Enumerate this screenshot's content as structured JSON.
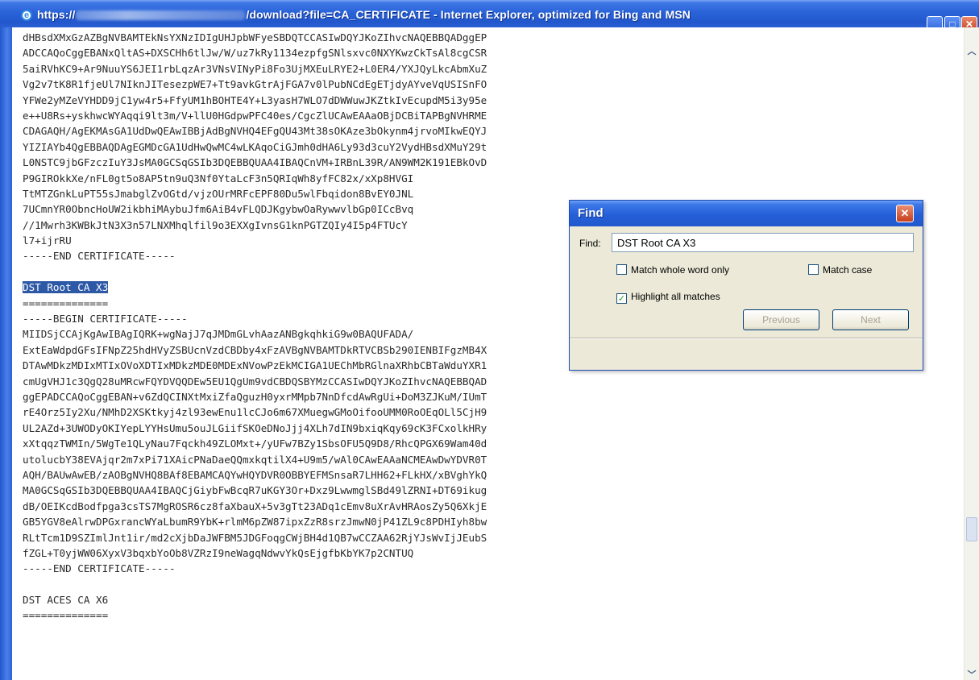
{
  "window": {
    "title_prefix": "https://",
    "title_suffix": "/download?file=CA_CERTIFICATE - Internet Explorer, optimized for Bing and MSN",
    "minimize_symbol": "_",
    "maximize_symbol": "□",
    "close_symbol": "✕"
  },
  "scrollbar": {
    "up_arrow": "︿",
    "down_arrow": "﹀"
  },
  "document": {
    "lines": [
      "dHBsdXMxGzAZBgNVBAMTEkNsYXNzIDIgUHJpbWFyeSBDQTCCASIwDQYJKoZIhvcNAQEBBQADggEP",
      "ADCCAQoCggEBANxQltAS+DXSCHh6tlJw/W/uz7kRy1134ezpfgSNlsxvc0NXYKwzCkTsAl8cgCSR",
      "5aiRVhKC9+Ar9NuuYS6JEI1rbLqzAr3VNsVINyPi8Fo3UjMXEuLRYE2+L0ER4/YXJQyLkcAbmXuZ",
      "Vg2v7tK8R1fjeUl7NIknJITesezpWE7+Tt9avkGtrAjFGA7v0lPubNCdEgETjdyAYveVqUSISnFO",
      "YFWe2yMZeVYHDD9jC1yw4r5+FfyUM1hBOHTE4Y+L3yasH7WLO7dDWWuwJKZtkIvEcupdM5i3y95e",
      "e++U8Rs+yskhwcWYAqqi9lt3m/V+llU0HGdpwPFC40es/CgcZlUCAwEAAaOBjDCBiTAPBgNVHRME",
      "CDAGAQH/AgEKMAsGA1UdDwQEAwIBBjAdBgNVHQ4EFgQU43Mt38sOKAze3bOkynm4jrvoMIkwEQYJ",
      "YIZIAYb4QgEBBAQDAgEGMDcGA1UdHwQwMC4wLKAqoCiGJmh0dHA6Ly93d3cuY2VydHBsdXMuY29t",
      "L0NSTC9jbGFzczIuY3JsMA0GCSqGSIb3DQEBBQUAA4IBAQCnVM+IRBnL39R/AN9WM2K191EBkOvD",
      "P9GIROkkXe/nFL0gt5o8AP5tn9uQ3Nf0YtaLcF3n5QRIqWh8yfFC82x/xXp8HVGI",
      "TtMTZGnkLuPT55sJmabglZvOGtd/vjzOUrMRFcEPF80Du5wlFbqidon8BvEY0JNL",
      "7UCmnYR0ObncHoUW2ikbhiMAybuJfm6AiB4vFLQDJKgybwOaRywwvlbGp0ICcBvq",
      "//1Mwrh3KWBkJtN3X3n57LNXMhqlfil9o3EXXgIvnsG1knPGTZQIy4I5p4FTUcY",
      "l7+ijrRU",
      "-----END CERTIFICATE-----",
      "",
      "DST Root CA X3",
      "==============",
      "-----BEGIN CERTIFICATE-----",
      "MIIDSjCCAjKgAwIBAgIQRK+wgNajJ7qJMDmGLvhAazANBgkqhkiG9w0BAQUFADA/",
      "ExtEaWdpdGFsIFNpZ25hdHVyZSBUcnVzdCBDby4xFzAVBgNVBAMTDkRTVCBSb290IENBIFgzMB4X",
      "DTAwMDkzMDIxMTIxOVoXDTIxMDkzMDE0MDExNVowPzEkMCIGA1UEChMbRGlnaXRhbCBTaWduYXR1",
      "cmUgVHJ1c3QgQ28uMRcwFQYDVQQDEw5EU1QgUm9vdCBDQSBYMzCCASIwDQYJKoZIhvcNAQEBBQAD",
      "ggEPADCCAQoCggEBAN+v6ZdQCINXtMxiZfaQguzH0yxrMMpb7NnDfcdAwRgUi+DoM3ZJKuM/IUmT",
      "rE4Orz5Iy2Xu/NMhD2XSKtkyj4zl93ewEnu1lcCJo6m67XMuegwGMoOifooUMM0RoOEqOLl5CjH9",
      "UL2AZd+3UWODyOKIYepLYYHsUmu5ouJLGiifSKOeDNoJjj4XLh7dIN9bxiqKqy69cK3FCxolkHRy",
      "xXtqqzTWMIn/5WgTe1QLyNau7Fqckh49ZLOMxt+/yUFw7BZy1SbsOFU5Q9D8/RhcQPGX69Wam40d",
      "utolucbY38EVAjqr2m7xPi71XAicPNaDaeQQmxkqtilX4+U9m5/wAl0CAwEAAaNCMEAwDwYDVR0T",
      "AQH/BAUwAwEB/zAOBgNVHQ8BAf8EBAMCAQYwHQYDVR0OBBYEFMSnsaR7LHH62+FLkHX/xBVghYkQ",
      "MA0GCSqGSIb3DQEBBQUAA4IBAQCjGiybFwBcqR7uKGY3Or+Dxz9LwwmglSBd49lZRNI+DT69ikug",
      "dB/OEIKcdBodfpga3csTS7MgROSR6cz8faXbauX+5v3gTt23ADq1cEmv8uXrAvHRAosZy5Q6XkjE",
      "GB5YGV8eAlrwDPGxrancWYaLbumR9YbK+rlmM6pZW87ipxZzR8srzJmwN0jP41ZL9c8PDHIyh8bw",
      "RLtTcm1D9SZImlJnt1ir/md2cXjbDaJWFBM5JDGFoqgCWjBH4d1QB7wCCZAA62RjYJsWvIjJEubS",
      "fZGL+T0yjWW06XyxV3bqxbYoOb8VZRzI9neWagqNdwvYkQsEjgfbKbYK7p2CNTUQ",
      "-----END CERTIFICATE-----",
      "",
      "DST ACES CA X6",
      "=============="
    ]
  },
  "find": {
    "title": "Find",
    "close_symbol": "✕",
    "find_label": "Find:",
    "query": "DST Root CA X3",
    "match_whole_word_label": "Match whole word only",
    "match_whole_word_checked": false,
    "match_case_label": "Match case",
    "match_case_checked": false,
    "highlight_all_label": "Highlight all matches",
    "highlight_all_checked": true,
    "check_mark": "✓",
    "previous_label": "Previous",
    "next_label": "Next"
  },
  "colors": {
    "titlebar": "#2a63d8",
    "highlight": "#2c58a6",
    "dialog_bg": "#ece9d8"
  }
}
